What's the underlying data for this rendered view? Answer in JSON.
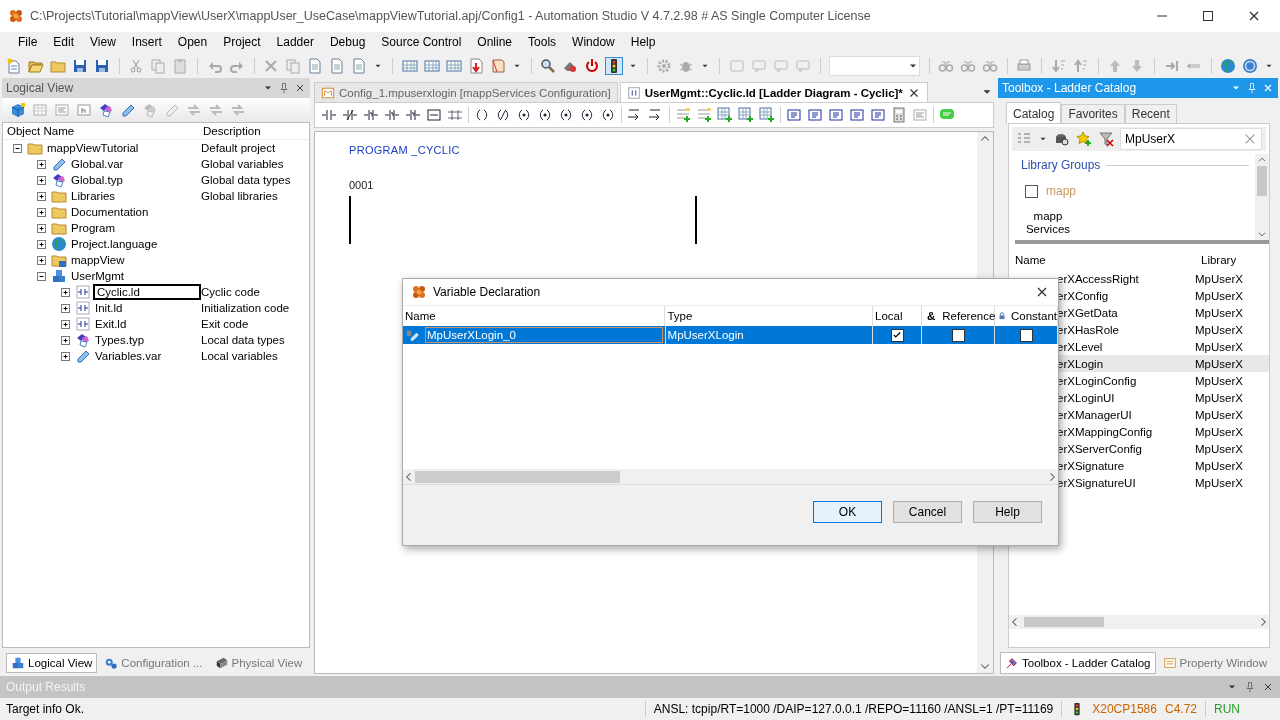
{
  "window": {
    "title": "C:\\Projects\\Tutorial\\mappView\\UserX\\mappUser_UseCase\\mappViewTutorial.apj/Config1 - Automation Studio V 4.7.2.98 # AS Single Computer License"
  },
  "menu": [
    "File",
    "Edit",
    "View",
    "Insert",
    "Open",
    "Project",
    "Ladder",
    "Debug",
    "Source Control",
    "Online",
    "Tools",
    "Window",
    "Help"
  ],
  "logical_view": {
    "title": "Logical View",
    "columns": [
      "Object Name",
      "Description"
    ],
    "tree": [
      {
        "name": "mappViewTutorial",
        "description": "Default project",
        "kind": "folder",
        "expanded": true,
        "selected": false,
        "children": [
          {
            "name": "Global.var",
            "description": "Global variables",
            "kind": "variables",
            "expanded": false,
            "selected": false
          },
          {
            "name": "Global.typ",
            "description": "Global data types",
            "kind": "datatypes",
            "expanded": false,
            "selected": false
          },
          {
            "name": "Libraries",
            "description": "Global libraries",
            "kind": "folder",
            "expanded": false,
            "selected": false
          },
          {
            "name": "Documentation",
            "kind": "folder",
            "expanded": false,
            "selected": false
          },
          {
            "name": "Program",
            "kind": "folder",
            "expanded": false,
            "selected": false
          },
          {
            "name": "Project.language",
            "kind": "language",
            "expanded": false,
            "selected": false
          },
          {
            "name": "mappView",
            "kind": "visualization",
            "expanded": false,
            "selected": false
          },
          {
            "name": "UserMgmt",
            "kind": "package",
            "expanded": true,
            "selected": false,
            "children": [
              {
                "name": "Cyclic.ld",
                "description": "Cyclic code",
                "kind": "program",
                "expanded": false,
                "selected": true
              },
              {
                "name": "Init.ld",
                "description": "Initialization code",
                "kind": "program",
                "expanded": false,
                "selected": false
              },
              {
                "name": "Exit.ld",
                "description": "Exit code",
                "kind": "program",
                "expanded": false,
                "selected": false
              },
              {
                "name": "Types.typ",
                "description": "Local data types",
                "kind": "datatypes",
                "expanded": false,
                "selected": false
              },
              {
                "name": "Variables.var",
                "description": "Local variables",
                "kind": "variables",
                "expanded": false,
                "selected": false
              }
            ]
          }
        ]
      }
    ],
    "tabs": [
      {
        "label": "Logical View",
        "kind": "logical",
        "selected": true
      },
      {
        "label": "Configuration ...",
        "kind": "configuration",
        "selected": false
      },
      {
        "label": "Physical View",
        "kind": "physical",
        "selected": false
      }
    ]
  },
  "editor": {
    "tabs": [
      {
        "label": "Config_1.mpuserxlogin [mappServices Configuration]",
        "kind": "config",
        "selected": false
      },
      {
        "label": "UserMgmt::Cyclic.ld [Ladder Diagram - Cyclic]*",
        "kind": "ladder",
        "selected": true
      }
    ],
    "program_header": "PROGRAM _CYCLIC",
    "network_number": "0001"
  },
  "dialog": {
    "title": "Variable Declaration",
    "columns": [
      {
        "label": "Name",
        "kind": "name"
      },
      {
        "label": "Type",
        "kind": "type"
      },
      {
        "label": "Local",
        "kind": "local"
      },
      {
        "label": "Reference",
        "kind": "reference",
        "symbol": "&"
      },
      {
        "label": "Constant",
        "kind": "constant"
      }
    ],
    "rows": [
      {
        "name": "MpUserXLogin_0",
        "type": "MpUserXLogin",
        "local": true,
        "reference": false,
        "constant": false,
        "selected": true
      }
    ],
    "buttons": [
      {
        "label": "OK",
        "default": true
      },
      {
        "label": "Cancel",
        "default": false
      },
      {
        "label": "Help",
        "default": false
      }
    ]
  },
  "toolbox": {
    "title": "Toolbox - Ladder Catalog",
    "tabs": [
      {
        "label": "Catalog",
        "selected": true
      },
      {
        "label": "Favorites",
        "selected": false
      },
      {
        "label": "Recent",
        "selected": false
      }
    ],
    "search": {
      "value": "MpUserX"
    },
    "groups_title": "Library Groups",
    "groups": [
      {
        "label": "mapp",
        "checked": false
      }
    ],
    "group_caption": "mapp Services",
    "columns": [
      "Name",
      "Library"
    ],
    "rows": [
      {
        "name": "erXAccessRight",
        "library": "MpUserX",
        "selected": false
      },
      {
        "name": "erXConfig",
        "library": "MpUserX",
        "selected": false
      },
      {
        "name": "erXGetData",
        "library": "MpUserX",
        "selected": false
      },
      {
        "name": "erXHasRole",
        "library": "MpUserX",
        "selected": false
      },
      {
        "name": "erXLevel",
        "library": "MpUserX",
        "selected": false
      },
      {
        "name": "erXLogin",
        "library": "MpUserX",
        "selected": true
      },
      {
        "name": "erXLoginConfig",
        "library": "MpUserX",
        "selected": false
      },
      {
        "name": "erXLoginUI",
        "library": "MpUserX",
        "selected": false
      },
      {
        "name": "erXManagerUI",
        "library": "MpUserX",
        "selected": false
      },
      {
        "name": "erXMappingConfig",
        "library": "MpUserX",
        "selected": false
      },
      {
        "name": "erXServerConfig",
        "library": "MpUserX",
        "selected": false
      },
      {
        "name": "erXSignature",
        "library": "MpUserX",
        "selected": false
      },
      {
        "name": "erXSignatureUI",
        "library": "MpUserX",
        "selected": false
      }
    ],
    "bottom_tabs": [
      {
        "label": "Toolbox - Ladder Catalog",
        "selected": true
      },
      {
        "label": "Property Window",
        "selected": false
      }
    ]
  },
  "output": {
    "title": "Output Results"
  },
  "status_bar": {
    "message": "Target info Ok.",
    "connection": "ANSL: tcpip/RT=1000 /DAIP=127.0.0.1 /REPO=11160 /ANSL=1 /PT=11169",
    "target": "X20CP1586",
    "version": "C4.72",
    "mode": "RUN"
  }
}
